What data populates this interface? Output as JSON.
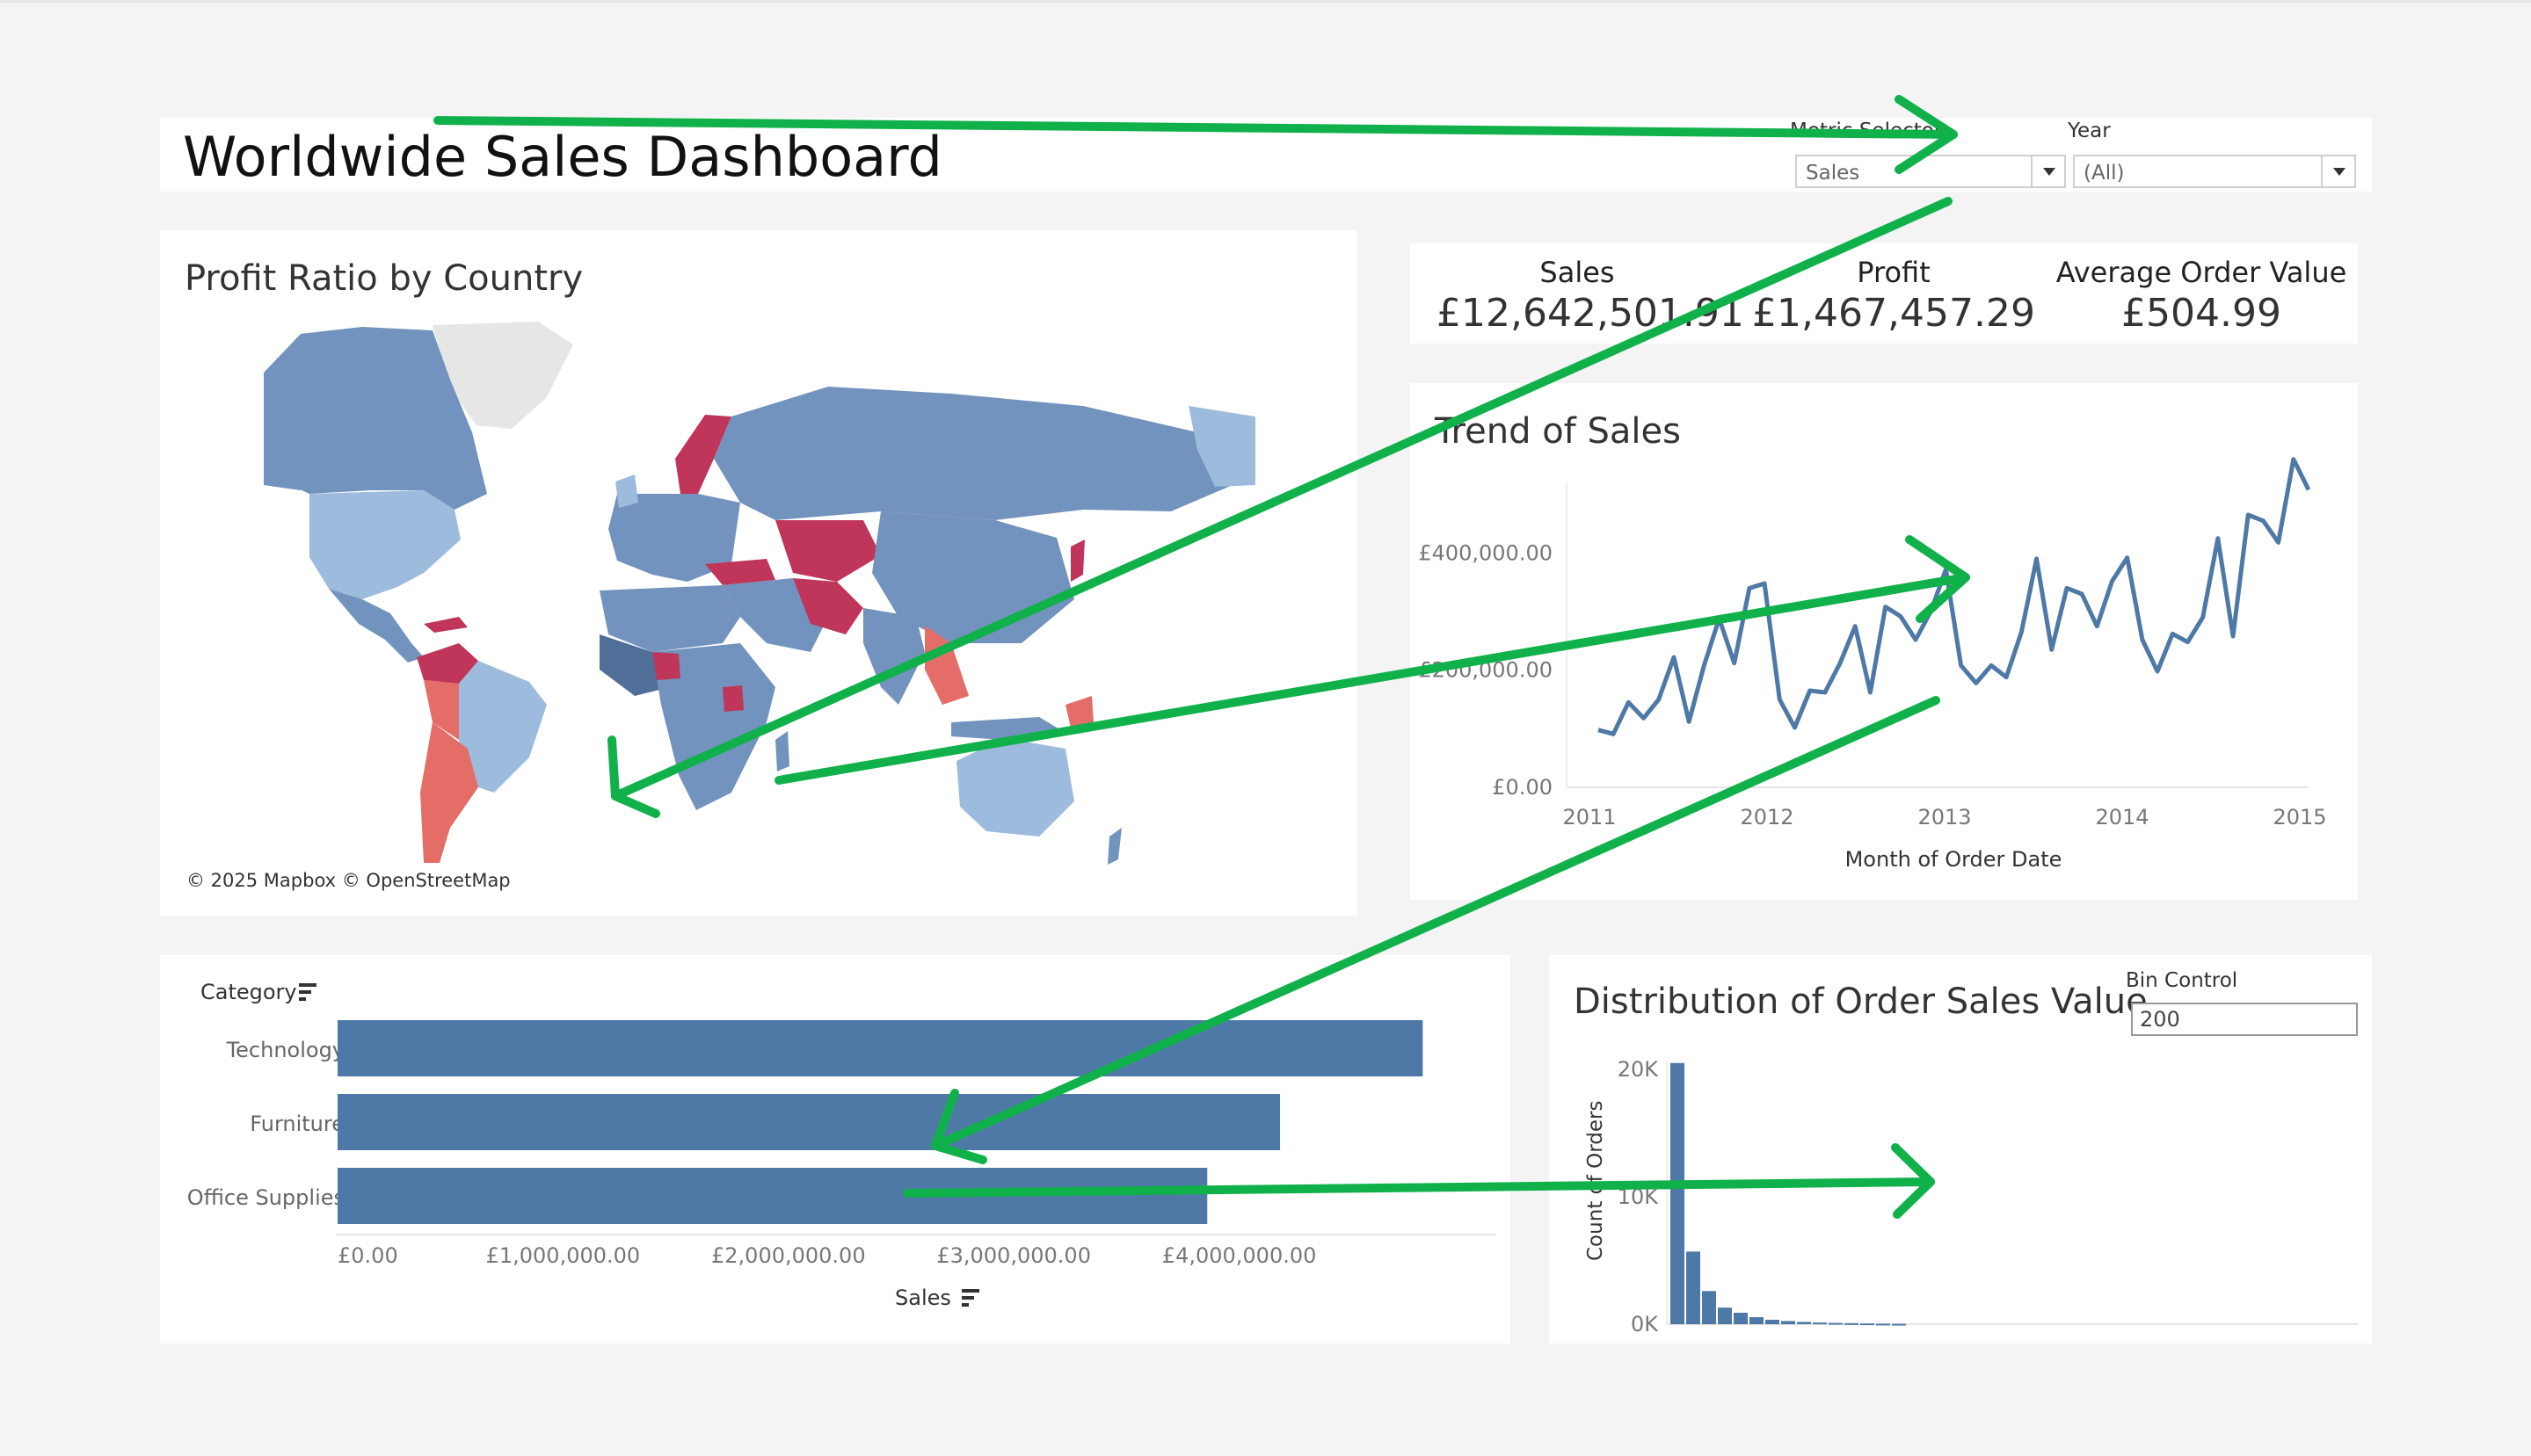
{
  "header": {
    "title": "Worldwide Sales Dashboard",
    "metric_selector": {
      "label": "Metric Selector",
      "value": "Sales"
    },
    "year_filter": {
      "label": "Year",
      "value": "(All)"
    }
  },
  "map": {
    "title": "Profit Ratio by Country",
    "credit": "© 2025 Mapbox © OpenStreetMap",
    "colors": {
      "positive": "#7293be",
      "light": "#9dbbdc",
      "dark": "#4f6f99",
      "negative": "#c0355a",
      "mild_negative": "#e56d68",
      "no_data": "#e6e6e6"
    }
  },
  "kpis": [
    {
      "label": "Sales",
      "value": "£12,642,501.91"
    },
    {
      "label": "Profit",
      "value": "£1,467,457.29"
    },
    {
      "label": "Average Order Value",
      "value": "£504.99"
    }
  ],
  "trend": {
    "title": "Trend of Sales",
    "chart_data": {
      "type": "line",
      "xlabel": "Month of Order Date",
      "ylabel": "",
      "x_ticks": [
        "2011",
        "2012",
        "2013",
        "2014",
        "2015"
      ],
      "y_ticks": [
        "£0.00",
        "£200,000.00",
        "£400,000.00"
      ],
      "ylim": [
        0,
        600000
      ],
      "x_start": "2011-01",
      "values": [
        98000,
        91000,
        145000,
        118000,
        150000,
        222000,
        112000,
        208000,
        288000,
        212000,
        340000,
        348000,
        150000,
        102000,
        165000,
        162000,
        212000,
        275000,
        162000,
        308000,
        292000,
        252000,
        300000,
        372000,
        208000,
        178000,
        208000,
        188000,
        265000,
        390000,
        235000,
        340000,
        330000,
        275000,
        352000,
        392000,
        252000,
        198000,
        262000,
        248000,
        290000,
        425000,
        258000,
        465000,
        455000,
        418000,
        560000,
        508000
      ]
    }
  },
  "category_bars": {
    "chart_data": {
      "type": "bar",
      "orientation": "horizontal",
      "ylabel": "Category",
      "xlabel": "Sales",
      "categories": [
        "Technology",
        "Furniture",
        "Office Supplies"
      ],
      "values": [
        4744000,
        4111000,
        3788000
      ],
      "x_ticks": [
        "£0.00",
        "£1,000,000.00",
        "£2,000,000.00",
        "£3,000,000.00",
        "£4,000,000.00"
      ],
      "xlim": [
        0,
        5000000
      ],
      "color": "#4e79a7"
    }
  },
  "distribution": {
    "title": "Distribution of Order Sales Value",
    "bin_control": {
      "label": "Bin Control",
      "value": "200"
    },
    "chart_data": {
      "type": "bar",
      "ylabel": "Count of Orders",
      "y_ticks": [
        "0K",
        "10K",
        "20K"
      ],
      "ylim": [
        0,
        20000
      ],
      "values": [
        20500,
        5700,
        2600,
        1300,
        900,
        550,
        350,
        250,
        180,
        130,
        100,
        80,
        60,
        40,
        30
      ],
      "color": "#4e79a7"
    }
  }
}
